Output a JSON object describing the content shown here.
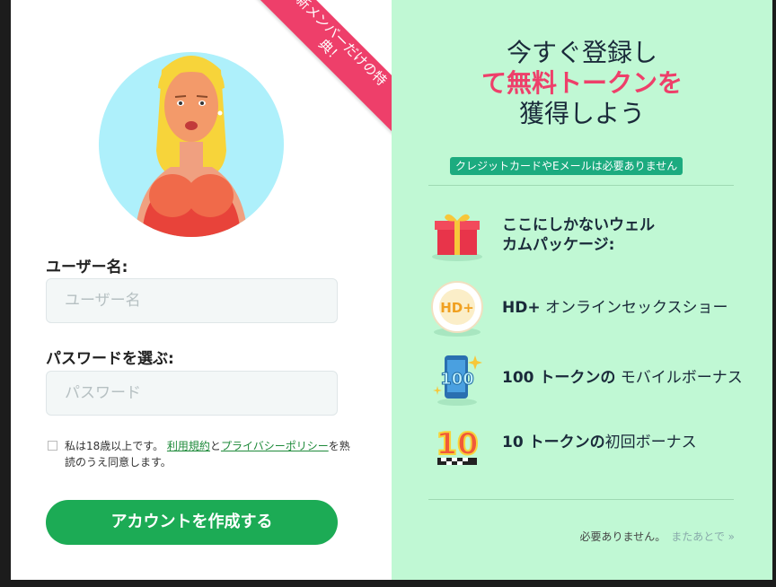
{
  "ribbon": {
    "line1": "新メンバーだけの特",
    "line2": "典！"
  },
  "form": {
    "username_label": "ユーザー名:",
    "username_placeholder": "ユーザー名",
    "password_label": "パスワードを選ぶ:",
    "password_placeholder": "パスワード",
    "agree_prefix": "私は18歳以上です。",
    "terms_link": "利用規約",
    "agree_and": "と",
    "privacy_link": "プライバシーポリシー",
    "agree_suffix": "を熟読のうえ同意します。",
    "submit_label": "アカウントを作成する"
  },
  "promo": {
    "headline_line1": "今すぐ登録し",
    "headline_line2": "て無料トークンを",
    "headline_line3": "獲得しよう",
    "no_card": "クレジットカードやEメールは必要ありません",
    "perks": [
      {
        "icon": "gift-icon",
        "bold": "ここにしかないウェル",
        "bold2": "カムパッケージ:",
        "rest": ""
      },
      {
        "icon": "hd-plus-icon",
        "bold": "HD+",
        "rest": " オンラインセックスショー"
      },
      {
        "icon": "mobile-100-icon",
        "bold": "100 トークンの",
        "rest": " モバイルボーナス"
      },
      {
        "icon": "tokens-10-icon",
        "bold": "10 トークンの",
        "rest": "初回ボーナス"
      }
    ],
    "not_needed": "必要ありません。",
    "later": "またあとで »"
  },
  "colors": {
    "accent_pink": "#ee3f6a",
    "cta_green": "#1cab55",
    "promo_bg": "#c0f8d4"
  }
}
